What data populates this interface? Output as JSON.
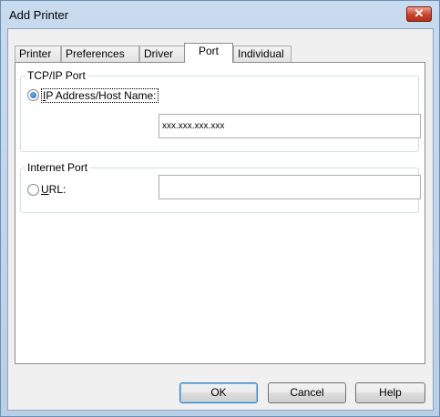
{
  "window": {
    "title": "Add Printer",
    "close_glyph": "✕"
  },
  "tabs": [
    {
      "label": "Printer"
    },
    {
      "label": "Preferences"
    },
    {
      "label": "Driver"
    },
    {
      "label": "Port",
      "active": true
    },
    {
      "label": "Individual"
    }
  ],
  "tcpip": {
    "legend": "TCP/IP Port",
    "radio_label_mnemonic": "I",
    "radio_label_rest": "P Address/Host Name:",
    "radio_checked": true,
    "address_value": "xxx.xxx.xxx.xxx"
  },
  "internet": {
    "legend": "Internet Port",
    "radio_label_mnemonic": "U",
    "radio_label_rest": "RL:",
    "radio_checked": false,
    "url_value": ""
  },
  "buttons": {
    "ok": "OK",
    "cancel": "Cancel",
    "help": "Help"
  },
  "colors": {
    "title_bar": "#c9dbee",
    "close_button": "#c7432c",
    "default_button_border": "#3c7fb1"
  }
}
